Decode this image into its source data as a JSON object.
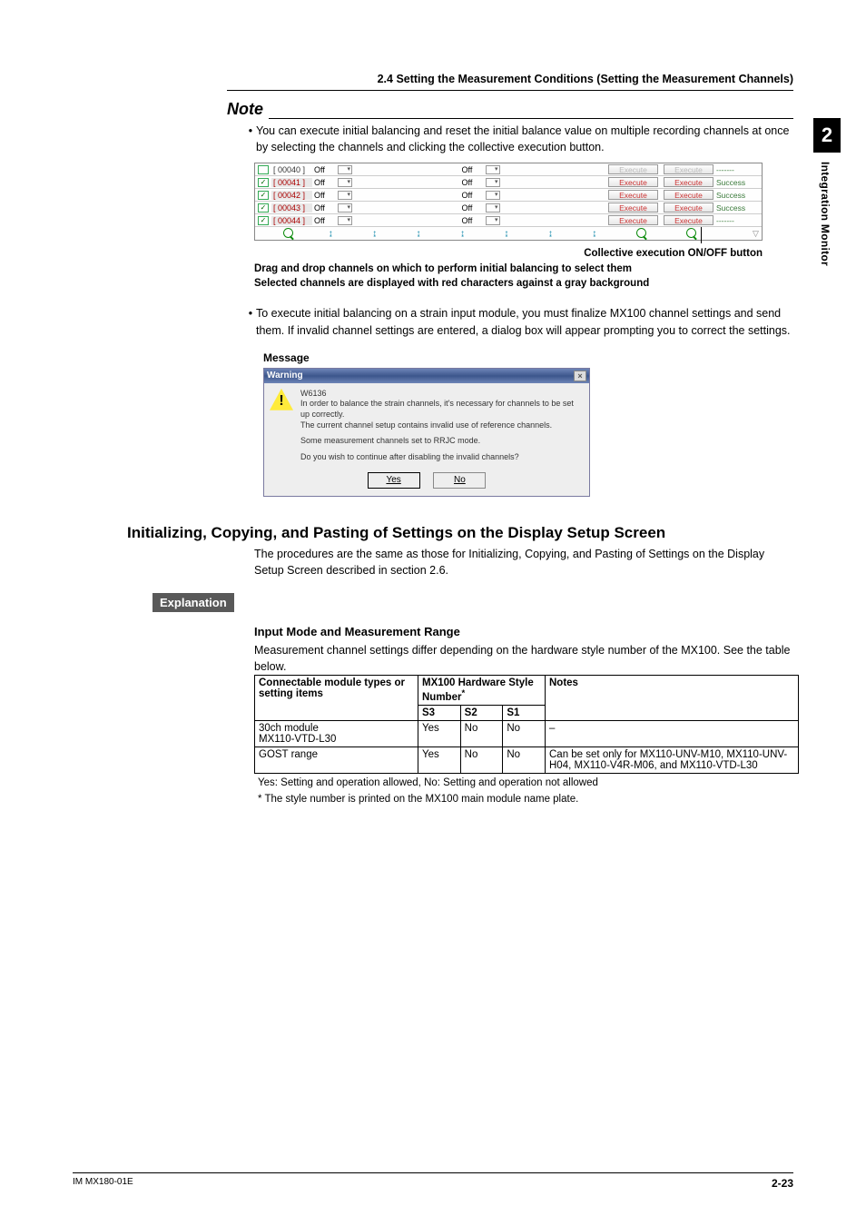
{
  "chapter": {
    "num": "2",
    "title": "Integration Monitor"
  },
  "header": "2.4  Setting the Measurement Conditions (Setting the Measurement Channels)",
  "note": {
    "label": "Note",
    "bullet1": "You can execute initial balancing and reset the initial balance value on multiple recording channels at once by selecting the channels and clicking the collective execution button."
  },
  "grid": {
    "rows": [
      {
        "ch": "[ 00040 ]",
        "sel": false,
        "off": "Off",
        "off2": "Off",
        "ex_gray": true,
        "suc": "-------"
      },
      {
        "ch": "[ 00041 ]",
        "sel": true,
        "off": "Off",
        "off2": "Off",
        "ex_gray": false,
        "suc": "Success"
      },
      {
        "ch": "[ 00042 ]",
        "sel": true,
        "off": "Off",
        "off2": "Off",
        "ex_gray": false,
        "suc": "Success"
      },
      {
        "ch": "[ 00043 ]",
        "sel": true,
        "off": "Off",
        "off2": "Off",
        "ex_gray": false,
        "suc": "Success"
      },
      {
        "ch": "[ 00044 ]",
        "sel": true,
        "off": "Off",
        "off2": "Off",
        "ex_gray": false,
        "suc": "-------"
      }
    ],
    "exec": "Execute",
    "tick": "↨"
  },
  "caption_collective": "Collective execution ON/OFF button",
  "caption_drag1": "Drag and drop channels on which to perform initial balancing to select them",
  "caption_drag2": "Selected channels are displayed with red characters against a gray background",
  "bullet2": "To execute initial balancing on a strain input module, you must finalize MX100 channel settings and send them. If invalid channel settings are entered, a dialog box will appear prompting you to correct the settings.",
  "msg_label": "Message",
  "dialog": {
    "title": "Warning",
    "code": "W6136",
    "line1": "In order to balance the strain channels, it's necessary for channels to be set up correctly.",
    "line2": "The current channel setup contains invalid use of reference channels.",
    "line3": "Some measurement channels set to RRJC mode.",
    "line4": "Do you wish to continue after disabling the invalid channels?",
    "yes": "Yes",
    "no": "No"
  },
  "h2": "Initializing, Copying, and Pasting of Settings on the Display Setup Screen",
  "h2_body": "The procedures are the same as those for Initializing, Copying, and Pasting of Settings on the Display Setup Screen described in section 2.6.",
  "explanation": "Explanation",
  "sub": "Input Mode and Measurement Range",
  "sub_body": "Measurement channel settings differ depending on the hardware style number of the MX100. See the table below.",
  "table": {
    "h1": "Connectable module types or setting items",
    "h2": "MX100 Hardware Style Number",
    "h2star": "*",
    "h3": "Notes",
    "s3": "S3",
    "s2": "S2",
    "s1": "S1",
    "rows": [
      {
        "c1a": "30ch module",
        "c1b": "MX110-VTD-L30",
        "s3": "Yes",
        "s2": "No",
        "s1": "No",
        "notes": "–"
      },
      {
        "c1a": "GOST range",
        "c1b": "",
        "s3": "Yes",
        "s2": "No",
        "s1": "No",
        "notes": "Can be set only for MX110-UNV-M10, MX110-UNV-H04, MX110-V4R-M06, and MX110-VTD-L30"
      }
    ]
  },
  "footnote1": "Yes: Setting and operation allowed, No: Setting and operation not allowed",
  "footnote2": "*  The style number is printed on the MX100 main module name plate.",
  "footer": {
    "left": "IM MX180-01E",
    "right": "2-23"
  }
}
